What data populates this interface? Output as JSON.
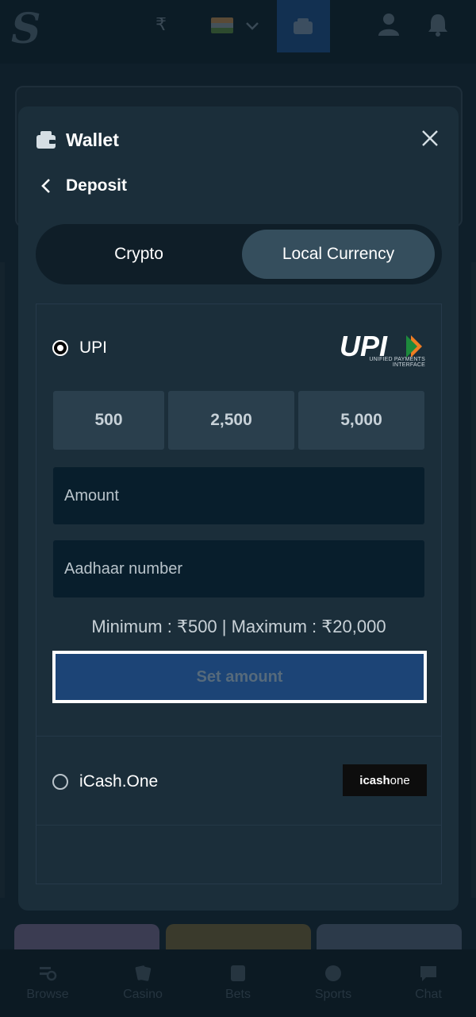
{
  "header": {
    "currency_symbol": "₹",
    "flag_colors": [
      "#ff9933",
      "#ffffff",
      "#138808"
    ]
  },
  "bottom_nav": {
    "items": [
      {
        "label": "Browse",
        "icon": "browse-icon"
      },
      {
        "label": "Casino",
        "icon": "casino-icon"
      },
      {
        "label": "Bets",
        "icon": "bets-icon"
      },
      {
        "label": "Sports",
        "icon": "sports-icon"
      },
      {
        "label": "Chat",
        "icon": "chat-icon"
      }
    ]
  },
  "modal": {
    "title": "Wallet",
    "back_label": "Deposit",
    "tabs": [
      {
        "label": "Crypto",
        "active": false
      },
      {
        "label": "Local Currency",
        "active": true
      }
    ],
    "methods": {
      "upi": {
        "name": "UPI",
        "selected": true,
        "logo_text": "UPI",
        "logo_subtext": "UNIFIED PAYMENTS INTERFACE",
        "quick_amounts": [
          "500",
          "2,500",
          "5,000"
        ],
        "amount_placeholder": "Amount",
        "aadhaar_placeholder": "Aadhaar number",
        "limits_text": "Minimum : ₹500 | Maximum : ₹20,000",
        "submit_label": "Set amount"
      },
      "icash": {
        "name": "iCash.One",
        "selected": false,
        "logo_text_bold": "icash",
        "logo_text_light": "one"
      }
    }
  },
  "colors": {
    "accent_blue": "#1c4476",
    "modal_bg": "#1b2e3a",
    "active_tab": "#354e5d"
  }
}
